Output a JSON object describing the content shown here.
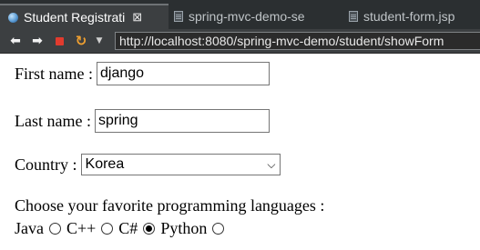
{
  "tabs": [
    {
      "label": "Student Registrati",
      "icon": "globe-icon",
      "active": true,
      "close": "⊠"
    },
    {
      "label": "spring-mvc-demo-se",
      "icon": "java-file-icon",
      "active": false
    },
    {
      "label": "student-form.jsp",
      "icon": "jsp-file-icon",
      "active": false
    }
  ],
  "navigation": {
    "back": "⬅",
    "forward": "➡",
    "refresh": "↻",
    "menu": "▼",
    "url": "http://localhost:8080/spring-mvc-demo/student/showForm"
  },
  "form": {
    "first_name_label": "First name :",
    "first_name_value": "django",
    "last_name_label": "Last name :",
    "last_name_value": "spring",
    "country_label": "Country :",
    "country_value": "Korea",
    "languages_prompt": "Choose your favorite programming languages :",
    "languages": [
      {
        "label": "Java",
        "checked": false
      },
      {
        "label": "C++",
        "checked": false
      },
      {
        "label": "C#",
        "checked": true
      },
      {
        "label": "Python",
        "checked": false
      }
    ]
  }
}
